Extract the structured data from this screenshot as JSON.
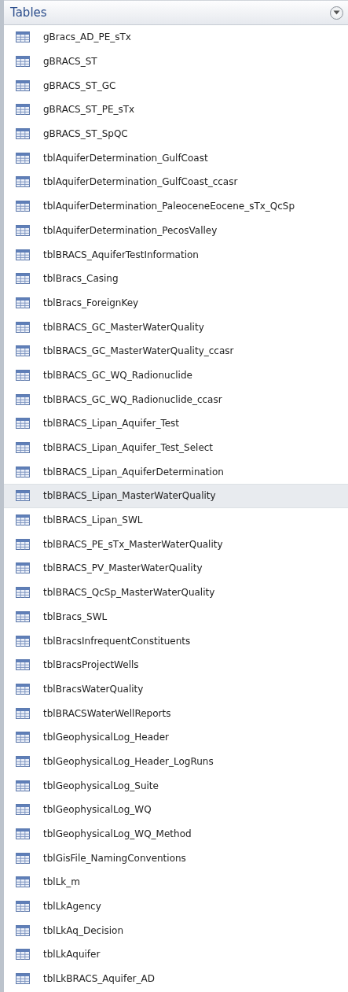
{
  "pane": {
    "title": "Tables",
    "items": [
      {
        "label": "gBracs_AD_PE_sTx",
        "selected": false
      },
      {
        "label": "gBRACS_ST",
        "selected": false
      },
      {
        "label": "gBRACS_ST_GC",
        "selected": false
      },
      {
        "label": "gBRACS_ST_PE_sTx",
        "selected": false
      },
      {
        "label": "gBRACS_ST_SpQC",
        "selected": false
      },
      {
        "label": "tblAquiferDetermination_GulfCoast",
        "selected": false
      },
      {
        "label": "tblAquiferDetermination_GulfCoast_ccasr",
        "selected": false
      },
      {
        "label": "tblAquiferDetermination_PaleoceneEocene_sTx_QcSp",
        "selected": false
      },
      {
        "label": "tblAquiferDetermination_PecosValley",
        "selected": false
      },
      {
        "label": "tblBRACS_AquiferTestInformation",
        "selected": false
      },
      {
        "label": "tblBracs_Casing",
        "selected": false
      },
      {
        "label": "tblBracs_ForeignKey",
        "selected": false
      },
      {
        "label": "tblBRACS_GC_MasterWaterQuality",
        "selected": false
      },
      {
        "label": "tblBRACS_GC_MasterWaterQuality_ccasr",
        "selected": false
      },
      {
        "label": "tblBRACS_GC_WQ_Radionuclide",
        "selected": false
      },
      {
        "label": "tblBRACS_GC_WQ_Radionuclide_ccasr",
        "selected": false
      },
      {
        "label": "tblBRACS_Lipan_Aquifer_Test",
        "selected": false
      },
      {
        "label": "tblBRACS_Lipan_Aquifer_Test_Select",
        "selected": false
      },
      {
        "label": "tblBRACS_Lipan_AquiferDetermination",
        "selected": false
      },
      {
        "label": "tblBRACS_Lipan_MasterWaterQuality",
        "selected": true
      },
      {
        "label": "tblBRACS_Lipan_SWL",
        "selected": false
      },
      {
        "label": "tblBRACS_PE_sTx_MasterWaterQuality",
        "selected": false
      },
      {
        "label": "tblBRACS_PV_MasterWaterQuality",
        "selected": false
      },
      {
        "label": "tblBRACS_QcSp_MasterWaterQuality",
        "selected": false
      },
      {
        "label": "tblBracs_SWL",
        "selected": false
      },
      {
        "label": "tblBracsInfrequentConstituents",
        "selected": false
      },
      {
        "label": "tblBracsProjectWells",
        "selected": false
      },
      {
        "label": "tblBracsWaterQuality",
        "selected": false
      },
      {
        "label": "tblBRACSWaterWellReports",
        "selected": false
      },
      {
        "label": "tblGeophysicalLog_Header",
        "selected": false
      },
      {
        "label": "tblGeophysicalLog_Header_LogRuns",
        "selected": false
      },
      {
        "label": "tblGeophysicalLog_Suite",
        "selected": false
      },
      {
        "label": "tblGeophysicalLog_WQ",
        "selected": false
      },
      {
        "label": "tblGeophysicalLog_WQ_Method",
        "selected": false
      },
      {
        "label": "tblGisFile_NamingConventions",
        "selected": false
      },
      {
        "label": "tblLk_m",
        "selected": false
      },
      {
        "label": "tblLkAgency",
        "selected": false
      },
      {
        "label": "tblLkAq_Decision",
        "selected": false
      },
      {
        "label": "tblLkAquifer",
        "selected": false
      },
      {
        "label": "tblLkBRACS_Aquifer_AD",
        "selected": false
      }
    ]
  }
}
